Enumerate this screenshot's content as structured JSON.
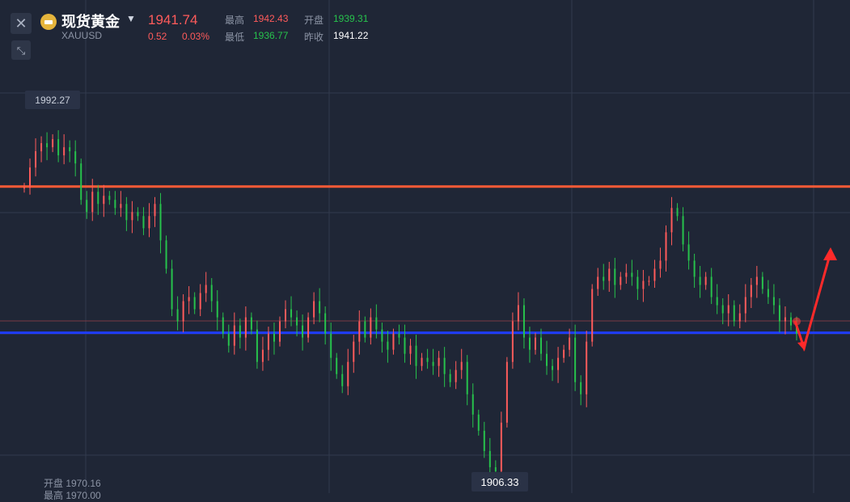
{
  "header": {
    "title": "现货黄金",
    "symbol": "XAUUSD",
    "price": "1941.74",
    "change": "0.52",
    "change_pct": "0.03%",
    "high_label": "最高",
    "high_value": "1942.43",
    "open_label": "开盘",
    "open_value": "1939.31",
    "low_label": "最低",
    "low_value": "1936.77",
    "prev_close_label": "昨收",
    "prev_close_value": "1941.22"
  },
  "toolbar": {
    "close_icon": "close-icon",
    "collapse_icon": "collapse-arrows-icon"
  },
  "chart_labels": {
    "max_value": "1992.27",
    "min_value": "1906.33"
  },
  "footer": {
    "open_text": "开盘 1970.16",
    "cut_text": "最高 1970.00"
  },
  "colors": {
    "up": "#ff5b5b",
    "down": "#27c24c",
    "resistance_line": "#ff5a36",
    "support_line": "#1f3cff",
    "arrow": "#ff2a2a"
  },
  "chart_data": {
    "type": "candlestick",
    "title": "",
    "ylabel": "",
    "xlabel": "",
    "ylim": [
      1903,
      2002
    ],
    "horizontal_lines": [
      {
        "name": "resistance",
        "value": 1978.3
      },
      {
        "name": "support",
        "value": 1942.2
      }
    ],
    "max_label_value": 1992.27,
    "min_label_value": 1906.33,
    "close_series": [
      1978,
      1983,
      1987,
      1989,
      1988,
      1990,
      1986,
      1988,
      1987,
      1984,
      1975,
      1972,
      1977,
      1974,
      1976,
      1975,
      1973,
      1974,
      1970,
      1972,
      1971,
      1968,
      1971,
      1974,
      1965,
      1958,
      1948,
      1945,
      1950,
      1951,
      1948,
      1952,
      1954,
      1950,
      1946,
      1942,
      1939,
      1944,
      1941,
      1946,
      1943,
      1935,
      1938,
      1942,
      1940,
      1945,
      1948,
      1946,
      1944,
      1941,
      1946,
      1950,
      1947,
      1942,
      1936,
      1932,
      1929,
      1935,
      1940,
      1945,
      1941,
      1946,
      1943,
      1940,
      1938,
      1942,
      1941,
      1937,
      1939,
      1934,
      1936,
      1935,
      1934,
      1936,
      1932,
      1930,
      1933,
      1935,
      1927,
      1922,
      1918,
      1913,
      1909,
      1908,
      1920,
      1935,
      1945,
      1949,
      1941,
      1938,
      1941,
      1937,
      1934,
      1933,
      1936,
      1938,
      1941,
      1930,
      1927,
      1940,
      1953,
      1956,
      1955,
      1958,
      1954,
      1956,
      1957,
      1956,
      1953,
      1955,
      1955,
      1958,
      1960,
      1967,
      1973,
      1971,
      1964,
      1960,
      1956,
      1954,
      1956,
      1951,
      1949,
      1947,
      1949,
      1945,
      1947,
      1951,
      1954,
      1956,
      1953,
      1951,
      1949,
      1945,
      1946,
      1944,
      1942
    ]
  }
}
